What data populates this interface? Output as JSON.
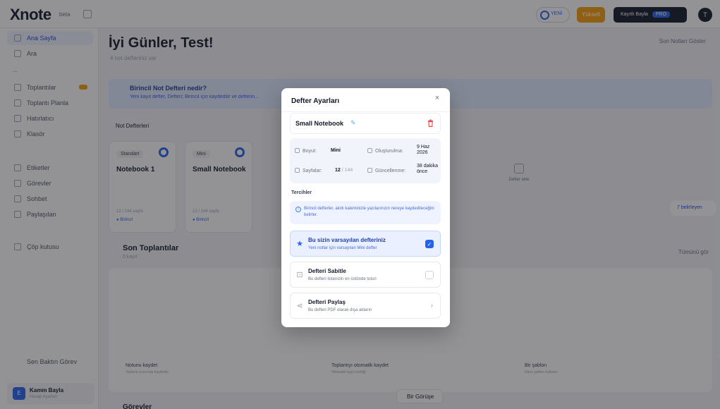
{
  "app": {
    "logo": "Xnote",
    "logo_badge": "beta",
    "new_pill": "YENİ",
    "orange_btn": "Yükselt",
    "dark_btn": "Kayıtlı Bayla",
    "dark_btn_tag": "PRO",
    "avatar_initial": "T"
  },
  "sidebar": {
    "items": [
      {
        "label": "Ana Sayfa",
        "active": true
      },
      {
        "label": "Ara"
      },
      {
        "label": "Toplantılar",
        "badge": true
      },
      {
        "label": "Toplantı Planla"
      },
      {
        "label": "Hatırlatıcı"
      },
      {
        "label": "Klasör"
      },
      {
        "label": "Etiketler"
      },
      {
        "label": "Görevler"
      },
      {
        "label": "Sohbet"
      },
      {
        "label": "Paylaşılan"
      },
      {
        "label": "Çöp kutusu"
      }
    ],
    "bottom_link": "Sen Baktın Görev",
    "user": {
      "name": "Kamm Bayla",
      "sub": "Hesap Ayarları",
      "initial": "E"
    }
  },
  "main": {
    "greeting": "İyi Günler, Test!",
    "greeting_sub": "4 not defteriniz var",
    "top_link": "Son Notları Göster",
    "banner_title": "Birincil Not Defteri nedir?",
    "banner_text": "Yeni kayıt defter, Defteri; Birincil için kaydedilir ve defterin...",
    "tabs": "Not Defterleri",
    "cards": [
      {
        "tag": "Standart",
        "title": "Notebook 1",
        "meta": "12 / 144 sayfa",
        "dot": "● Birincil"
      },
      {
        "tag": "Mini",
        "title": "Small Notebook",
        "meta": "12 / 144 sayfa",
        "dot": "● Birincil"
      }
    ],
    "ghost_card": "Defter ekle",
    "right_float": "7 belirleyen",
    "meetings_title": "Son Toplantılar",
    "meetings_sub": "0 kayıt",
    "see_all": "Tümünü gör",
    "features": [
      {
        "title": "Notunu kaydet",
        "sub": "Toplantı sırasında kaydedin"
      },
      {
        "title": "Toplantıyı otomatik kaydet",
        "sub": "Otomatik kayıt özelliği"
      },
      {
        "title": "Bir şablon",
        "sub": "Hazır şablon kullanın"
      }
    ],
    "start_btn": "Bir Görüşe",
    "more_title": "Görevler"
  },
  "modal": {
    "title": "Defter Ayarları",
    "close": "×",
    "notebook_name": "Small Notebook",
    "info": {
      "size_label": "Boyut:",
      "size_value": "Mini",
      "created_label": "Oluşturulma:",
      "created_value_line1": "9 Haz",
      "created_value_line2": "2026",
      "pages_label": "Sayfalar:",
      "pages_used": "12",
      "pages_total": "/ 144",
      "updated_label": "Güncellenme:",
      "updated_value_line1": "38 dakika",
      "updated_value_line2": "önce"
    },
    "prefs_label": "Tercihler",
    "note": "Birincil defterler, akıllı kaleminizle yazılarınızın nereye kaydedileceğini belirler.",
    "options": [
      {
        "title": "Bu sizin varsayılan defteriniz",
        "sub": "Yeni notlar için varsayılan Mini defter",
        "selected": true,
        "icon": "★"
      },
      {
        "title": "Defteri Sabitle",
        "sub": "Bu defteri listenizin en üstünde tutun",
        "selected": false,
        "icon": "⊡"
      },
      {
        "title": "Defteri Paylaş",
        "sub": "Bu defteri PDF olarak dışa aktarın",
        "selected": false,
        "icon": "⋖"
      }
    ],
    "check_mark": "✓",
    "chevron": "›",
    "pencil": "✎"
  },
  "colors": {
    "accent": "#2563eb",
    "danger": "#ef4444",
    "overlay": "#1e1e23"
  }
}
